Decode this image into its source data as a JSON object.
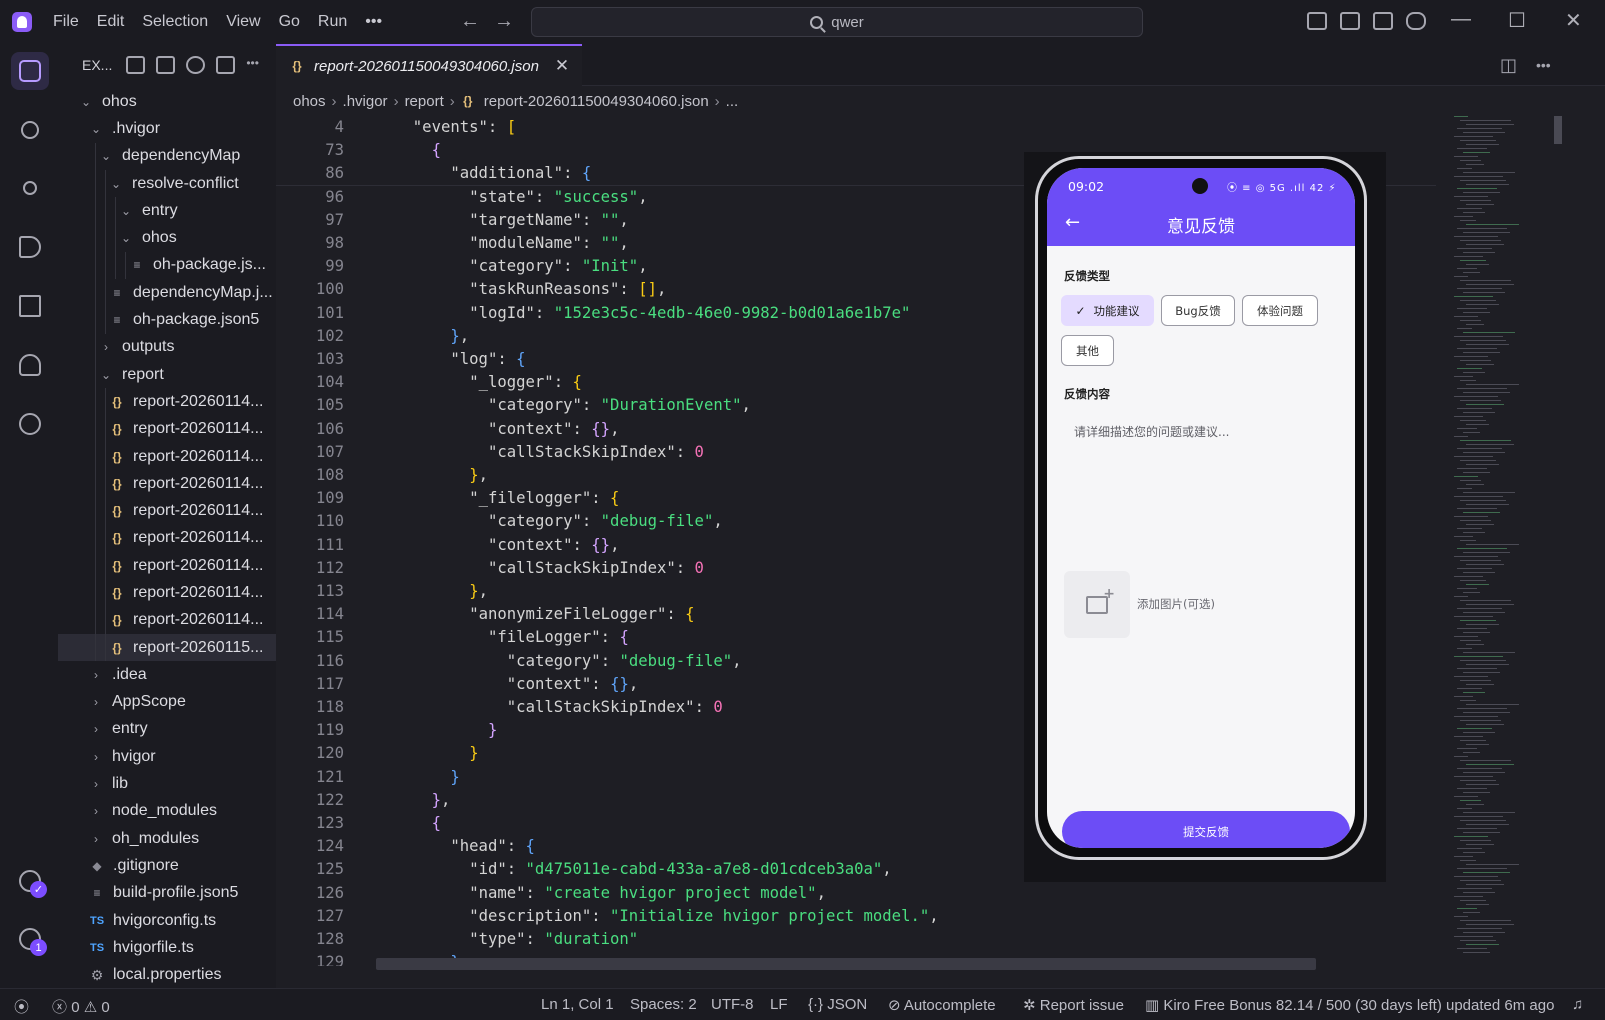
{
  "menu": [
    "File",
    "Edit",
    "Selection",
    "View",
    "Go",
    "Run",
    "•••"
  ],
  "search": {
    "value": "qwer"
  },
  "explorer": {
    "title": "EX...",
    "tree": [
      {
        "label": "ohos",
        "indent": 0,
        "kind": "folder-open"
      },
      {
        "label": ".hvigor",
        "indent": 1,
        "kind": "folder-open"
      },
      {
        "label": "dependencyMap",
        "indent": 2,
        "kind": "folder-open"
      },
      {
        "label": "resolve-conflict",
        "indent": 3,
        "kind": "folder-open"
      },
      {
        "label": "entry",
        "indent": 4,
        "kind": "folder-open"
      },
      {
        "label": "ohos",
        "indent": 4,
        "kind": "folder-open"
      },
      {
        "label": "oh-package.js...",
        "indent": 5,
        "kind": "txt"
      },
      {
        "label": "dependencyMap.j...",
        "indent": 3,
        "kind": "txt"
      },
      {
        "label": "oh-package.json5",
        "indent": 3,
        "kind": "txt"
      },
      {
        "label": "outputs",
        "indent": 2,
        "kind": "folder"
      },
      {
        "label": "report",
        "indent": 2,
        "kind": "folder-open"
      },
      {
        "label": "report-20260114...",
        "indent": 3,
        "kind": "json"
      },
      {
        "label": "report-20260114...",
        "indent": 3,
        "kind": "json"
      },
      {
        "label": "report-20260114...",
        "indent": 3,
        "kind": "json"
      },
      {
        "label": "report-20260114...",
        "indent": 3,
        "kind": "json"
      },
      {
        "label": "report-20260114...",
        "indent": 3,
        "kind": "json"
      },
      {
        "label": "report-20260114...",
        "indent": 3,
        "kind": "json"
      },
      {
        "label": "report-20260114...",
        "indent": 3,
        "kind": "json"
      },
      {
        "label": "report-20260114...",
        "indent": 3,
        "kind": "json"
      },
      {
        "label": "report-20260114...",
        "indent": 3,
        "kind": "json"
      },
      {
        "label": "report-20260115...",
        "indent": 3,
        "kind": "json",
        "selected": true
      },
      {
        "label": ".idea",
        "indent": 1,
        "kind": "folder"
      },
      {
        "label": "AppScope",
        "indent": 1,
        "kind": "folder"
      },
      {
        "label": "entry",
        "indent": 1,
        "kind": "folder"
      },
      {
        "label": "hvigor",
        "indent": 1,
        "kind": "folder"
      },
      {
        "label": "lib",
        "indent": 1,
        "kind": "folder"
      },
      {
        "label": "node_modules",
        "indent": 1,
        "kind": "folder"
      },
      {
        "label": "oh_modules",
        "indent": 1,
        "kind": "folder"
      },
      {
        "label": ".gitignore",
        "indent": 1,
        "kind": "git"
      },
      {
        "label": "build-profile.json5",
        "indent": 1,
        "kind": "txt"
      },
      {
        "label": "hvigorconfig.ts",
        "indent": 1,
        "kind": "ts"
      },
      {
        "label": "hvigorfile.ts",
        "indent": 1,
        "kind": "ts"
      },
      {
        "label": "local.properties",
        "indent": 1,
        "kind": "gear"
      }
    ]
  },
  "editor": {
    "tab_label": "report-202601150049304060.json",
    "breadcrumb": [
      "ohos",
      ".hvigor",
      "report",
      "report-202601150049304060.json",
      "..."
    ],
    "sticky": [
      {
        "num": "4",
        "indent": 1,
        "tokens": [
          [
            "k",
            "\"events\""
          ],
          [
            "p",
            ": "
          ],
          [
            "b1",
            "["
          ]
        ]
      },
      {
        "num": "73",
        "indent": 2,
        "tokens": [
          [
            "b2",
            "{"
          ]
        ]
      },
      {
        "num": "86",
        "indent": 3,
        "tokens": [
          [
            "k",
            "\"additional\""
          ],
          [
            "p",
            ": "
          ],
          [
            "b3",
            "{"
          ]
        ]
      }
    ],
    "lines": [
      {
        "num": "96",
        "indent": 4,
        "tokens": [
          [
            "k",
            "\"state\""
          ],
          [
            "p",
            ": "
          ],
          [
            "s",
            "\"success\""
          ],
          [
            "p",
            ","
          ]
        ]
      },
      {
        "num": "97",
        "indent": 4,
        "tokens": [
          [
            "k",
            "\"targetName\""
          ],
          [
            "p",
            ": "
          ],
          [
            "s",
            "\"\""
          ],
          [
            "p",
            ","
          ]
        ]
      },
      {
        "num": "98",
        "indent": 4,
        "tokens": [
          [
            "k",
            "\"moduleName\""
          ],
          [
            "p",
            ": "
          ],
          [
            "s",
            "\"\""
          ],
          [
            "p",
            ","
          ]
        ]
      },
      {
        "num": "99",
        "indent": 4,
        "tokens": [
          [
            "k",
            "\"category\""
          ],
          [
            "p",
            ": "
          ],
          [
            "s",
            "\"Init\""
          ],
          [
            "p",
            ","
          ]
        ]
      },
      {
        "num": "100",
        "indent": 4,
        "tokens": [
          [
            "k",
            "\"taskRunReasons\""
          ],
          [
            "p",
            ": "
          ],
          [
            "b1",
            "[]"
          ],
          [
            "p",
            ","
          ]
        ]
      },
      {
        "num": "101",
        "indent": 4,
        "tokens": [
          [
            "k",
            "\"logId\""
          ],
          [
            "p",
            ": "
          ],
          [
            "s",
            "\"152e3c5c-4edb-46e0-9982-b0d01a6e1b7e\""
          ]
        ]
      },
      {
        "num": "102",
        "indent": 3,
        "tokens": [
          [
            "b3",
            "}"
          ],
          [
            "p",
            ","
          ]
        ]
      },
      {
        "num": "103",
        "indent": 3,
        "tokens": [
          [
            "k",
            "\"log\""
          ],
          [
            "p",
            ": "
          ],
          [
            "b3",
            "{"
          ]
        ]
      },
      {
        "num": "104",
        "indent": 4,
        "tokens": [
          [
            "k",
            "\"_logger\""
          ],
          [
            "p",
            ": "
          ],
          [
            "b1",
            "{"
          ]
        ]
      },
      {
        "num": "105",
        "indent": 5,
        "tokens": [
          [
            "k",
            "\"category\""
          ],
          [
            "p",
            ": "
          ],
          [
            "s",
            "\"DurationEvent\""
          ],
          [
            "p",
            ","
          ]
        ]
      },
      {
        "num": "106",
        "indent": 5,
        "tokens": [
          [
            "k",
            "\"context\""
          ],
          [
            "p",
            ": "
          ],
          [
            "b2",
            "{}"
          ],
          [
            "p",
            ","
          ]
        ]
      },
      {
        "num": "107",
        "indent": 5,
        "tokens": [
          [
            "k",
            "\"callStackSkipIndex\""
          ],
          [
            "p",
            ": "
          ],
          [
            "n",
            "0"
          ]
        ]
      },
      {
        "num": "108",
        "indent": 4,
        "tokens": [
          [
            "b1",
            "}"
          ],
          [
            "p",
            ","
          ]
        ]
      },
      {
        "num": "109",
        "indent": 4,
        "tokens": [
          [
            "k",
            "\"_filelogger\""
          ],
          [
            "p",
            ": "
          ],
          [
            "b1",
            "{"
          ]
        ]
      },
      {
        "num": "110",
        "indent": 5,
        "tokens": [
          [
            "k",
            "\"category\""
          ],
          [
            "p",
            ": "
          ],
          [
            "s",
            "\"debug-file\""
          ],
          [
            "p",
            ","
          ]
        ]
      },
      {
        "num": "111",
        "indent": 5,
        "tokens": [
          [
            "k",
            "\"context\""
          ],
          [
            "p",
            ": "
          ],
          [
            "b2",
            "{}"
          ],
          [
            "p",
            ","
          ]
        ]
      },
      {
        "num": "112",
        "indent": 5,
        "tokens": [
          [
            "k",
            "\"callStackSkipIndex\""
          ],
          [
            "p",
            ": "
          ],
          [
            "n",
            "0"
          ]
        ]
      },
      {
        "num": "113",
        "indent": 4,
        "tokens": [
          [
            "b1",
            "}"
          ],
          [
            "p",
            ","
          ]
        ]
      },
      {
        "num": "114",
        "indent": 4,
        "tokens": [
          [
            "k",
            "\"anonymizeFileLogger\""
          ],
          [
            "p",
            ": "
          ],
          [
            "b1",
            "{"
          ]
        ]
      },
      {
        "num": "115",
        "indent": 5,
        "tokens": [
          [
            "k",
            "\"fileLogger\""
          ],
          [
            "p",
            ": "
          ],
          [
            "b2",
            "{"
          ]
        ]
      },
      {
        "num": "116",
        "indent": 6,
        "tokens": [
          [
            "k",
            "\"category\""
          ],
          [
            "p",
            ": "
          ],
          [
            "s",
            "\"debug-file\""
          ],
          [
            "p",
            ","
          ]
        ]
      },
      {
        "num": "117",
        "indent": 6,
        "tokens": [
          [
            "k",
            "\"context\""
          ],
          [
            "p",
            ": "
          ],
          [
            "b3",
            "{}"
          ],
          [
            "p",
            ","
          ]
        ]
      },
      {
        "num": "118",
        "indent": 6,
        "tokens": [
          [
            "k",
            "\"callStackSkipIndex\""
          ],
          [
            "p",
            ": "
          ],
          [
            "n",
            "0"
          ]
        ]
      },
      {
        "num": "119",
        "indent": 5,
        "tokens": [
          [
            "b2",
            "}"
          ]
        ]
      },
      {
        "num": "120",
        "indent": 4,
        "tokens": [
          [
            "b1",
            "}"
          ]
        ]
      },
      {
        "num": "121",
        "indent": 3,
        "tokens": [
          [
            "b3",
            "}"
          ]
        ]
      },
      {
        "num": "122",
        "indent": 2,
        "tokens": [
          [
            "b2",
            "}"
          ],
          [
            "p",
            ","
          ]
        ]
      },
      {
        "num": "123",
        "indent": 2,
        "tokens": [
          [
            "b2",
            "{"
          ]
        ]
      },
      {
        "num": "124",
        "indent": 3,
        "tokens": [
          [
            "k",
            "\"head\""
          ],
          [
            "p",
            ": "
          ],
          [
            "b3",
            "{"
          ]
        ]
      },
      {
        "num": "125",
        "indent": 4,
        "tokens": [
          [
            "k",
            "\"id\""
          ],
          [
            "p",
            ": "
          ],
          [
            "s",
            "\"d475011e-cabd-433a-a7e8-d01cdceb3a0a\""
          ],
          [
            "p",
            ","
          ]
        ]
      },
      {
        "num": "126",
        "indent": 4,
        "tokens": [
          [
            "k",
            "\"name\""
          ],
          [
            "p",
            ": "
          ],
          [
            "s",
            "\"create hvigor project model\""
          ],
          [
            "p",
            ","
          ]
        ]
      },
      {
        "num": "127",
        "indent": 4,
        "tokens": [
          [
            "k",
            "\"description\""
          ],
          [
            "p",
            ": "
          ],
          [
            "s",
            "\"Initialize hvigor project model.\""
          ],
          [
            "p",
            ","
          ]
        ]
      },
      {
        "num": "128",
        "indent": 4,
        "tokens": [
          [
            "k",
            "\"type\""
          ],
          [
            "p",
            ": "
          ],
          [
            "s",
            "\"duration\""
          ]
        ]
      },
      {
        "num": "129",
        "indent": 3,
        "tokens": [
          [
            "b3",
            "}"
          ],
          [
            "p",
            ","
          ]
        ]
      }
    ]
  },
  "phone": {
    "time": "09:02",
    "status_icons": "⦿ ≡ ◎ 5G .ıll 42 ⚡",
    "title": "意见反馈",
    "type_label": "反馈类型",
    "chips": [
      {
        "label": "功能建议",
        "active": true
      },
      {
        "label": "Bug反馈",
        "active": false
      },
      {
        "label": "体验问题",
        "active": false
      },
      {
        "label": "其他",
        "active": false
      }
    ],
    "content_label": "反馈内容",
    "content_placeholder": "请详细描述您的问题或建议...",
    "image_label": "添加图片(可选)",
    "submit_label": "提交反馈"
  },
  "statusbar": {
    "errors": "0",
    "warnings": "0",
    "cursor": "Ln 1, Col 1",
    "spaces": "Spaces: 2",
    "encoding": "UTF-8",
    "eol": "LF",
    "language": "JSON",
    "autocomplete": "Autocomplete",
    "report_issue": "Report issue",
    "bonus": "Kiro Free Bonus 82.14 / 500 (30 days left) updated 6m ago"
  },
  "accounts_badge": "1"
}
